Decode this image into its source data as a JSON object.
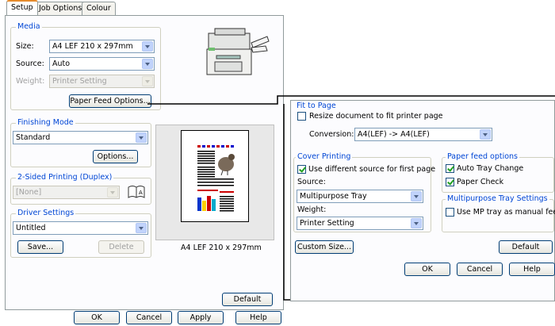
{
  "tabs": [
    "Setup",
    "Job Options",
    "Colour"
  ],
  "media": {
    "label": "Media",
    "size_label": "Size:",
    "size_value": "A4 LEF 210 x 297mm",
    "source_label": "Source:",
    "source_value": "Auto",
    "weight_label": "Weight:",
    "weight_value": "Printer Setting",
    "paper_feed_button": "Paper Feed Options..."
  },
  "finishing": {
    "label": "Finishing Mode",
    "value": "Standard",
    "options_button": "Options..."
  },
  "duplex": {
    "label": "2-Sided Printing (Duplex)",
    "value": "[None]"
  },
  "driver": {
    "label": "Driver Settings",
    "value": "Untitled",
    "save_button": "Save...",
    "delete_button": "Delete"
  },
  "preview": {
    "caption": "A4 LEF 210 x 297mm"
  },
  "default_button": "Default",
  "bottom_buttons": [
    "OK",
    "Cancel",
    "Apply",
    "Help"
  ],
  "feed_dialog": {
    "fit_label": "Fit to Page",
    "resize_label": "Resize document to fit printer page",
    "resize_checked": false,
    "conversion_label": "Conversion:",
    "conversion_value": "A4(LEF) -> A4(LEF)",
    "cover_label": "Cover Printing",
    "use_diff_label": "Use different source for first page",
    "use_diff_checked": true,
    "source_label": "Source:",
    "source_value": "Multipurpose Tray",
    "weight_label": "Weight:",
    "weight_value": "Printer Setting",
    "feed_options_label": "Paper feed options",
    "auto_tray_label": "Auto Tray Change",
    "auto_tray_checked": true,
    "paper_check_label": "Paper Check",
    "paper_check_checked": true,
    "mp_label": "Multipurpose Tray Settings",
    "mp_manual_label": "Use MP tray as manual feed",
    "mp_manual_checked": false,
    "custom_size_button": "Custom Size...",
    "default_button": "Default",
    "buttons": [
      "OK",
      "Cancel",
      "Help"
    ]
  }
}
